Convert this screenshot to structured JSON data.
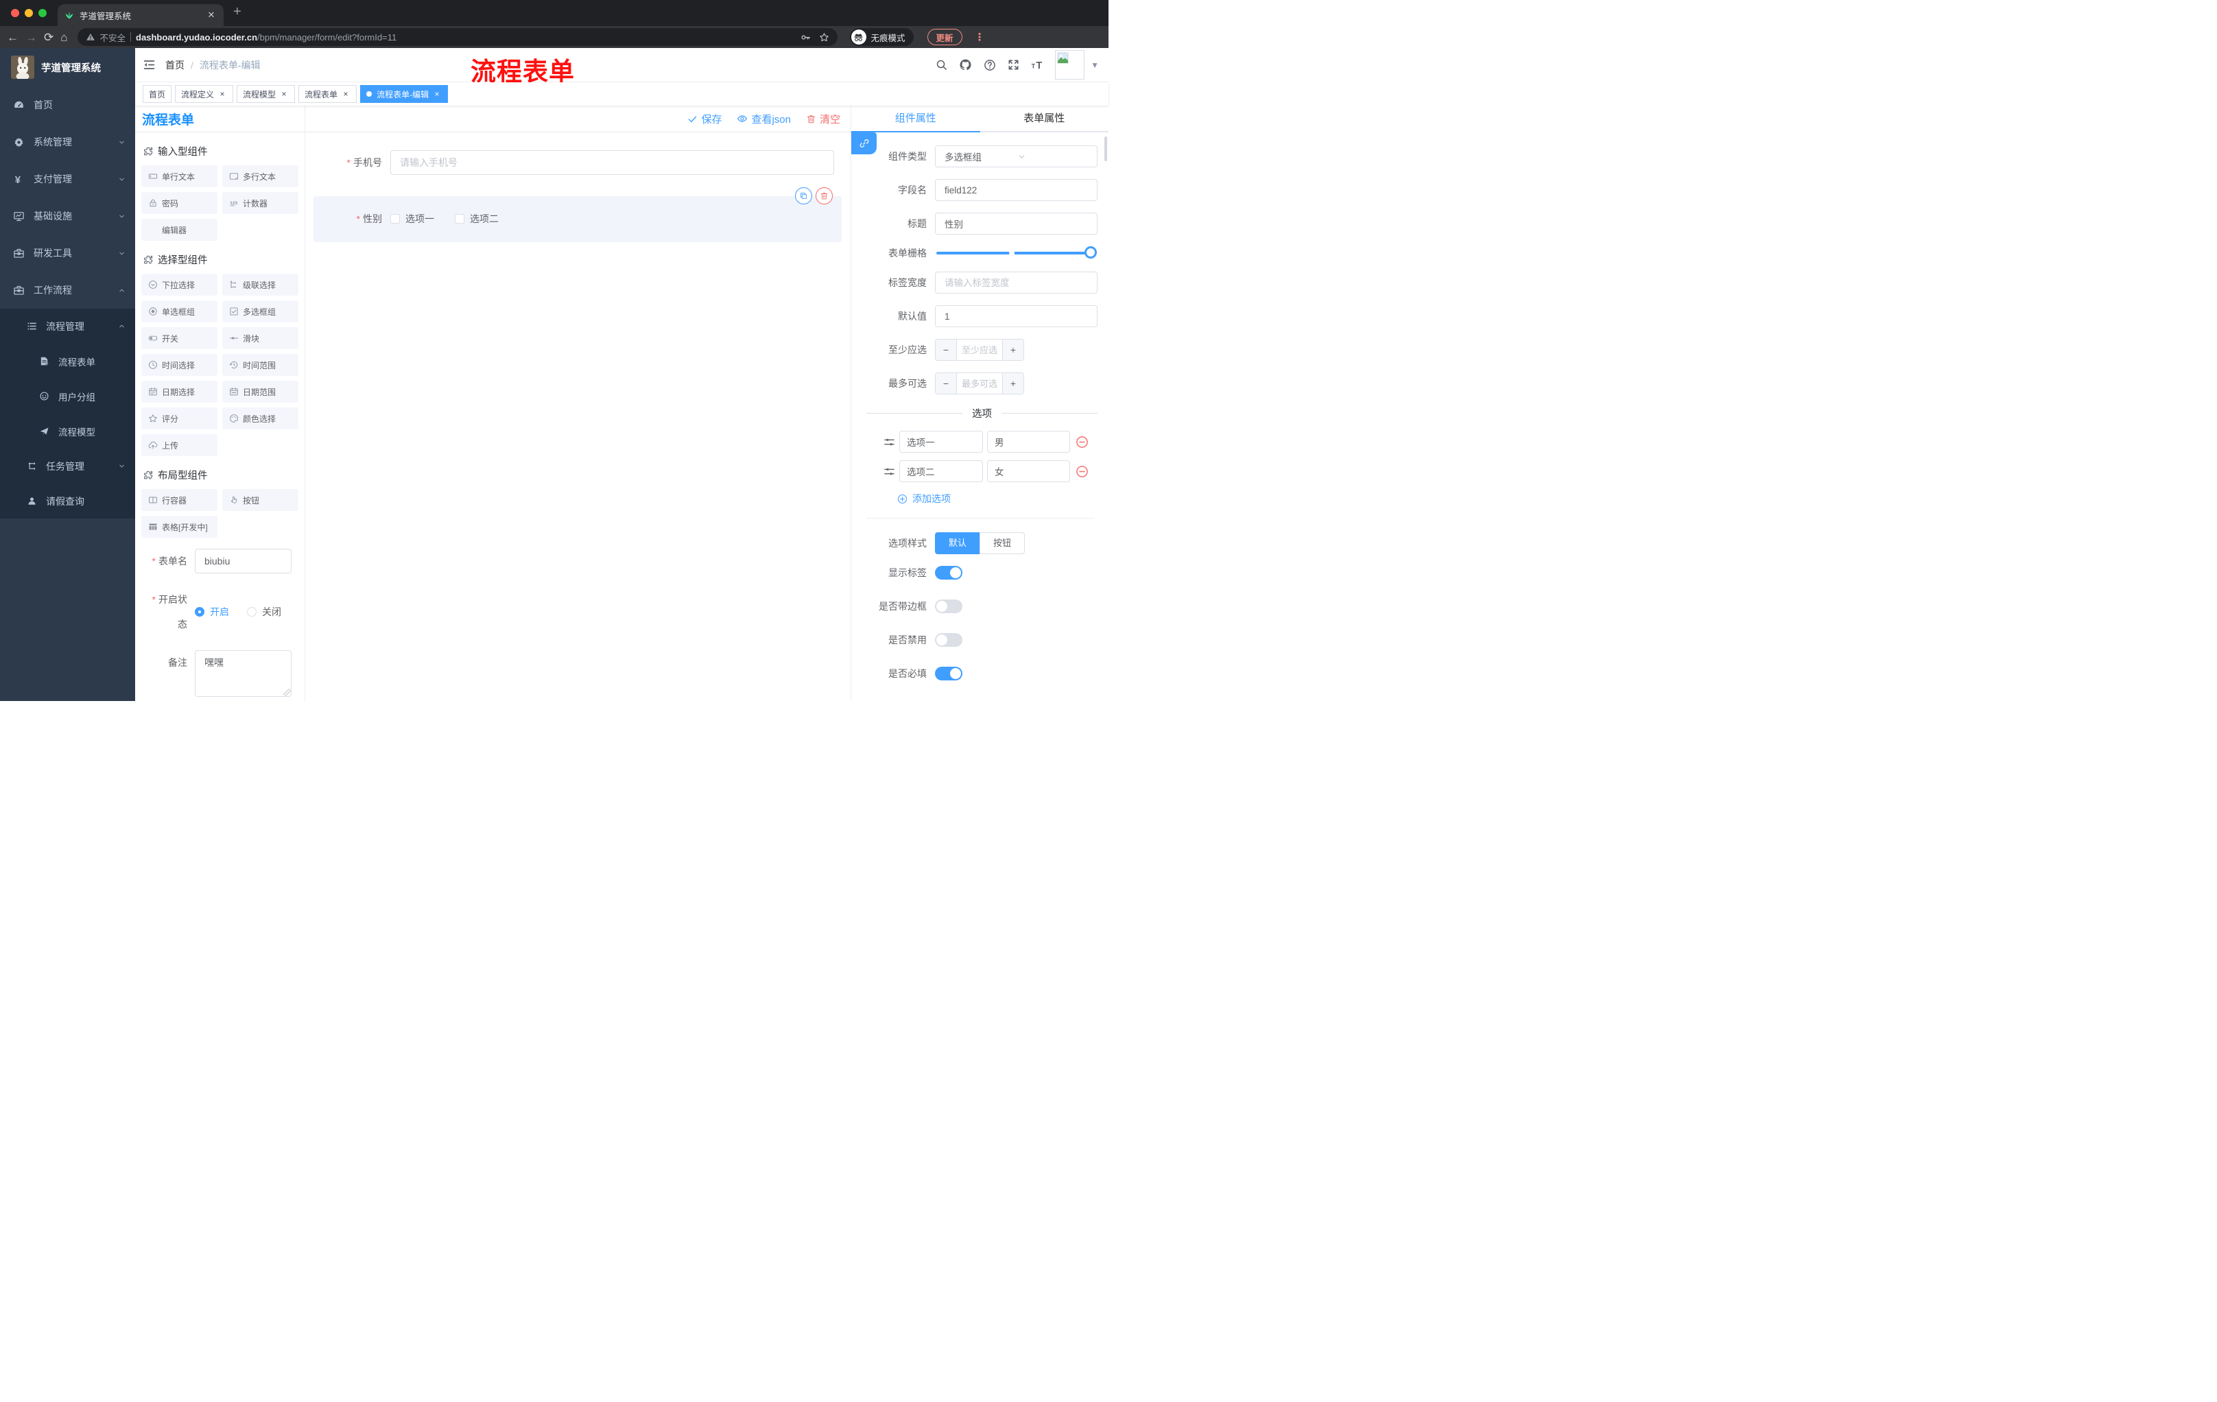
{
  "chrome": {
    "tab_title": "芋道管理系统",
    "not_secure": "不安全",
    "url_domain": "dashboard.yudao.iocoder.cn",
    "url_path": "/bpm/manager/form/edit?formId=11",
    "incognito": "无痕模式",
    "update": "更新"
  },
  "sidebar": {
    "logo_title": "芋道管理系统",
    "menu": [
      {
        "label": "首页",
        "icon": "dashboard",
        "arrow": null,
        "level": 1,
        "sub": false
      },
      {
        "label": "系统管理",
        "icon": "gear",
        "arrow": "down",
        "level": 1,
        "sub": false
      },
      {
        "label": "支付管理",
        "icon": "yen",
        "arrow": "down",
        "level": 1,
        "sub": false
      },
      {
        "label": "基础设施",
        "icon": "monitor",
        "arrow": "down",
        "level": 1,
        "sub": false
      },
      {
        "label": "研发工具",
        "icon": "toolbox",
        "arrow": "down",
        "level": 1,
        "sub": false
      },
      {
        "label": "工作流程",
        "icon": "toolbox",
        "arrow": "up",
        "level": 1,
        "sub": false
      },
      {
        "label": "流程管理",
        "icon": "list3",
        "arrow": "up",
        "level": 2,
        "sub": true
      },
      {
        "label": "流程表单",
        "icon": "formdoc",
        "arrow": null,
        "level": 3,
        "sub": true
      },
      {
        "label": "用户分组",
        "icon": "face",
        "arrow": null,
        "level": 3,
        "sub": true
      },
      {
        "label": "流程模型",
        "icon": "plane",
        "arrow": null,
        "level": 3,
        "sub": true
      },
      {
        "label": "任务管理",
        "icon": "tree",
        "arrow": "down",
        "level": 2,
        "sub": true
      },
      {
        "label": "请假查询",
        "icon": "user",
        "arrow": null,
        "level": 2,
        "sub": true
      }
    ]
  },
  "header": {
    "breadcrumb_home": "首页",
    "breadcrumb_current": "流程表单-编辑",
    "overlay_title": "流程表单"
  },
  "tags": [
    {
      "label": "首页",
      "closable": false,
      "active": false
    },
    {
      "label": "流程定义",
      "closable": true,
      "active": false
    },
    {
      "label": "流程模型",
      "closable": true,
      "active": false
    },
    {
      "label": "流程表单",
      "closable": true,
      "active": false
    },
    {
      "label": "流程表单-编辑",
      "closable": true,
      "active": true
    }
  ],
  "designer": {
    "panel_title": "流程表单",
    "actions": {
      "save": "保存",
      "view_json": "查看json",
      "clear": "清空"
    },
    "palette_sections": [
      {
        "title": "输入型组件",
        "items": [
          {
            "label": "单行文本",
            "icon": "input"
          },
          {
            "label": "多行文本",
            "icon": "textarea"
          },
          {
            "label": "密码",
            "icon": "lock"
          },
          {
            "label": "计数器",
            "icon": "counter"
          },
          {
            "label": "编辑器",
            "icon": null
          }
        ]
      },
      {
        "title": "选择型组件",
        "items": [
          {
            "label": "下拉选择",
            "icon": "select"
          },
          {
            "label": "级联选择",
            "icon": "cascade"
          },
          {
            "label": "单选框组",
            "icon": "radio"
          },
          {
            "label": "多选框组",
            "icon": "checkbox"
          },
          {
            "label": "开关",
            "icon": "switch"
          },
          {
            "label": "滑块",
            "icon": "slider"
          },
          {
            "label": "时间选择",
            "icon": "time"
          },
          {
            "label": "时间范围",
            "icon": "timerange"
          },
          {
            "label": "日期选择",
            "icon": "date"
          },
          {
            "label": "日期范围",
            "icon": "daterange"
          },
          {
            "label": "评分",
            "icon": "rate"
          },
          {
            "label": "颜色选择",
            "icon": "color"
          },
          {
            "label": "上传",
            "icon": "upload"
          }
        ]
      },
      {
        "title": "布局型组件",
        "items": [
          {
            "label": "行容器",
            "icon": "rowc"
          },
          {
            "label": "按钮",
            "icon": "hand"
          },
          {
            "label": "表格[开发中]",
            "icon": "table"
          }
        ]
      }
    ],
    "meta_form": {
      "name_label": "表单名",
      "name_value": "biubiu",
      "status_label": "开启状态",
      "status_on": "开启",
      "status_off": "关闭",
      "remark_label": "备注",
      "remark_value": "嘿嘿"
    },
    "canvas": {
      "phone_label": "手机号",
      "phone_placeholder": "请输入手机号",
      "gender_label": "性别",
      "gender_option1": "选项一",
      "gender_option2": "选项二"
    }
  },
  "props": {
    "tab_component": "组件属性",
    "tab_form": "表单属性",
    "type_label": "组件类型",
    "type_value": "多选框组",
    "field_label": "字段名",
    "field_value": "field122",
    "title_label": "标题",
    "title_value": "性别",
    "grid_label": "表单栅格",
    "width_label": "标签宽度",
    "width_placeholder": "请输入标签宽度",
    "default_label": "默认值",
    "default_value": "1",
    "min_label": "至少应选",
    "min_placeholder": "至少应选",
    "max_label": "最多可选",
    "max_placeholder": "最多可选",
    "options_title": "选项",
    "options": [
      {
        "name": "选项一",
        "value": "男"
      },
      {
        "name": "选项二",
        "value": "女"
      }
    ],
    "add_option": "添加选项",
    "style_label": "选项样式",
    "style_default": "默认",
    "style_button": "按钮",
    "switches": [
      {
        "label": "显示标签",
        "on": true
      },
      {
        "label": "是否带边框",
        "on": false
      },
      {
        "label": "是否禁用",
        "on": false
      },
      {
        "label": "是否必填",
        "on": true
      }
    ]
  },
  "colors": {
    "accent": "#409eff",
    "danger": "#f56c6c",
    "title_blue": "#1890ff",
    "overlay_red": "#fe1010",
    "sidebar_bg": "#2d3a4b",
    "submenu_bg": "#1f2d3d"
  }
}
